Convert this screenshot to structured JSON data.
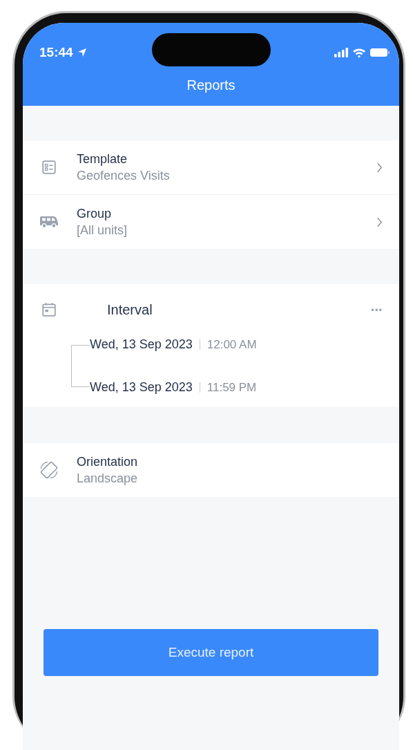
{
  "status_bar": {
    "time": "15:44"
  },
  "header": {
    "title": "Reports"
  },
  "settings": [
    {
      "kind": "nav",
      "label": "Template",
      "value": "Geofences Visits"
    },
    {
      "kind": "nav",
      "label": "Group",
      "value": "[All units]"
    }
  ],
  "interval": {
    "label": "Interval",
    "more": "•••",
    "ranges": [
      {
        "date": "Wed, 13 Sep 2023",
        "time": "12:00 AM"
      },
      {
        "date": "Wed, 13 Sep 2023",
        "time": "11:59 PM"
      }
    ]
  },
  "options": [
    {
      "kind": "value",
      "label": "Orientation",
      "value": "Landscape"
    }
  ],
  "action_button": {
    "label": "Execute report"
  }
}
